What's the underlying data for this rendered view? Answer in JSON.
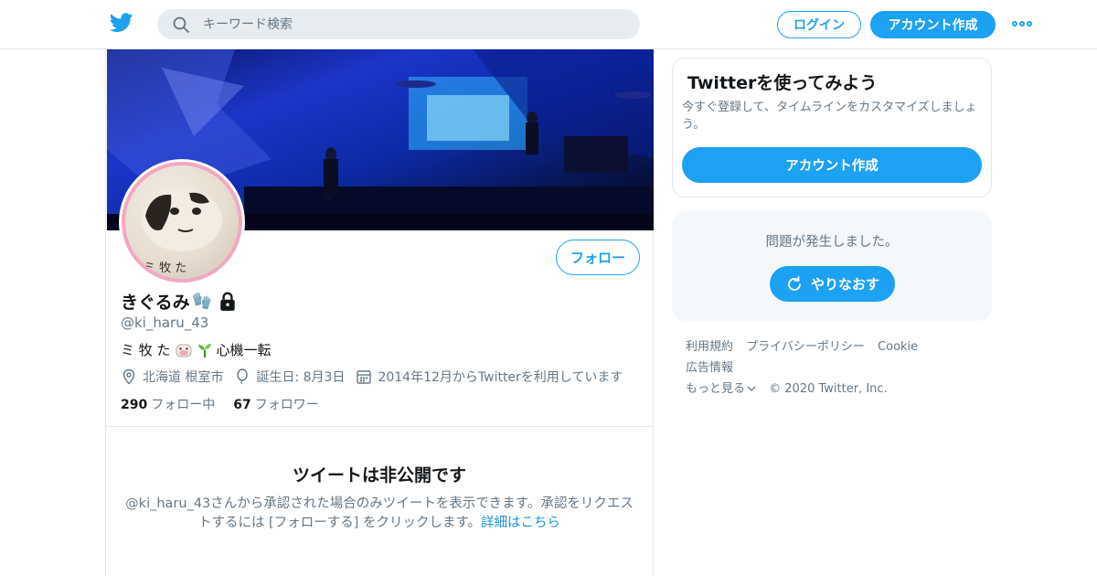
{
  "header": {
    "search_placeholder": "キーワード検索",
    "login_label": "ログイン",
    "signup_label": "アカウント作成"
  },
  "profile": {
    "name": "きぐるみ",
    "name_emoji": "🧤",
    "handle": "@ki_haru_43",
    "bio_prefix": "ミ 牧 た",
    "bio_suffix": "心機一転",
    "location": "北海道 根室市",
    "birthday": "誕生日: 8月3日",
    "joined": "2014年12月からTwitterを利用しています",
    "following_count": "290",
    "following_label": "フォロー中",
    "followers_count": "67",
    "followers_label": "フォロワー",
    "follow_button": "フォロー",
    "avatar_text": "ミ 牧 た"
  },
  "protected": {
    "title": "ツイートは非公開です",
    "text": "@ki_haru_43さんから承認された場合のみツイートを表示できます。承認をリクエストするには [フォローする] をクリックします。",
    "link": "詳細はこちら"
  },
  "sidebar": {
    "title": "Twitterを使ってみよう",
    "subtitle": "今すぐ登録して、タイムラインをカスタマイズしましょう。",
    "signup_button": "アカウント作成",
    "error_text": "問題が発生しました。",
    "retry_button": "やりなおす"
  },
  "footer": {
    "terms": "利用規約",
    "privacy": "プライバシーポリシー",
    "cookie": "Cookie",
    "ads": "広告情報",
    "more": "もっと見る",
    "copyright": "© 2020 Twitter, Inc."
  },
  "colors": {
    "accent": "#1da1f2",
    "avatar_ring": "#f1a8c2",
    "secondary_text": "#657786"
  }
}
